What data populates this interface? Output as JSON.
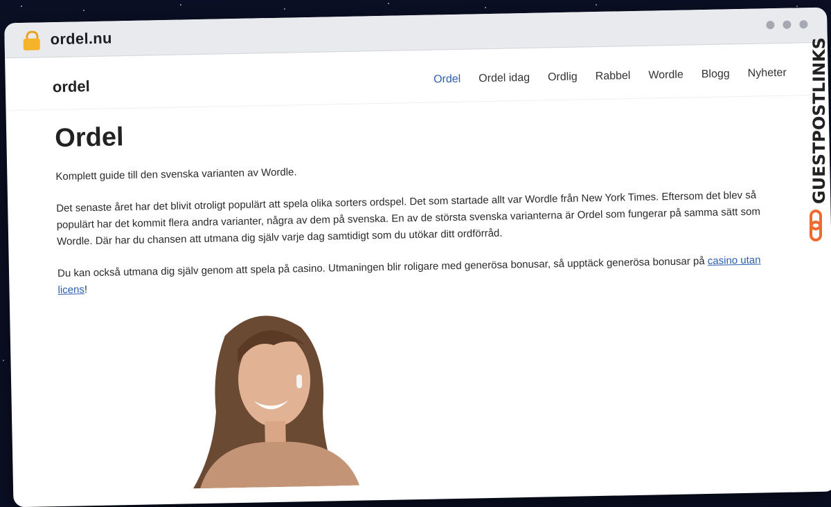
{
  "browser": {
    "url": "ordel.nu",
    "lock_icon": "lock-icon"
  },
  "header": {
    "logo": "ordel",
    "nav": [
      {
        "label": "Ordel",
        "active": true
      },
      {
        "label": "Ordel idag",
        "active": false
      },
      {
        "label": "Ordlig",
        "active": false
      },
      {
        "label": "Rabbel",
        "active": false
      },
      {
        "label": "Wordle",
        "active": false
      },
      {
        "label": "Blogg",
        "active": false
      },
      {
        "label": "Nyheter",
        "active": false
      }
    ]
  },
  "main": {
    "title": "Ordel",
    "intro": "Komplett guide till den svenska varianten av Wordle.",
    "body": "Det senaste året har det blivit otroligt populärt att spela olika sorters ordspel. Det som startade allt var Wordle från New York Times. Eftersom det blev så populärt har det kommit flera andra varianter, några av dem på svenska. En av de största svenska varianterna är Ordel som fungerar på samma sätt som Wordle. Där har du chansen att utmana dig själv varje dag samtidigt som du utökar ditt ordförråd.",
    "casino_text": "Du kan också utmana dig själv genom att spela på casino. Utmaningen blir roligare med generösa bonusar, så upptäck generösa bonusar på ",
    "casino_link": "casino utan licens",
    "casino_suffix": "!"
  },
  "watermark": {
    "text": "GUESTPOSTLINKS"
  },
  "colors": {
    "link": "#2f5db1",
    "background": "#0b1026",
    "chrome": "#e9eaee",
    "watermark_orange": "#f06a2e"
  }
}
